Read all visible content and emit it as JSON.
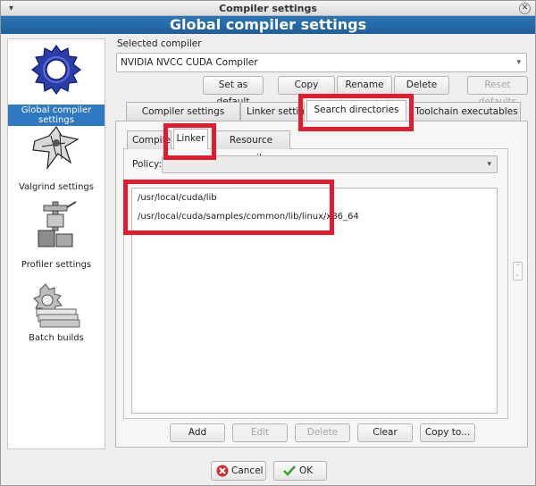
{
  "window": {
    "title": "Compiler settings",
    "menu_glyph": "▾",
    "close_glyph": "✕"
  },
  "banner": {
    "title": "Global compiler settings"
  },
  "sidebar": {
    "items": [
      {
        "label": "Global compiler settings",
        "icon": "gear-icon",
        "selected": true
      },
      {
        "label": "Valgrind settings",
        "icon": "valgrind-icon",
        "selected": false
      },
      {
        "label": "Profiler settings",
        "icon": "profiler-icon",
        "selected": false
      },
      {
        "label": "Batch builds",
        "icon": "batch-builds-icon",
        "selected": false
      }
    ]
  },
  "selected_compiler": {
    "label": "Selected compiler",
    "value": "NVIDIA NVCC CUDA Compiler"
  },
  "compiler_buttons": {
    "set_default": "Set as default",
    "copy": "Copy",
    "rename": "Rename",
    "delete": "Delete",
    "reset_defaults": "Reset defaults"
  },
  "main_tabs": [
    {
      "label": "Compiler settings",
      "active": false
    },
    {
      "label": "Linker settings",
      "active": false
    },
    {
      "label": "Search directories",
      "active": true
    },
    {
      "label": "Toolchain executables",
      "active": false
    }
  ],
  "sub_tabs": [
    {
      "label": "Compiler",
      "active": false
    },
    {
      "label": "Linker",
      "active": true
    },
    {
      "label": "Resource compiler",
      "active": false
    }
  ],
  "policy": {
    "label": "Policy:",
    "value": ""
  },
  "directories": [
    "/usr/local/cuda/lib",
    "/usr/local/cuda/samples/common/lib/linux/x86_64"
  ],
  "dir_buttons": {
    "add": "Add",
    "edit": "Edit",
    "delete": "Delete",
    "clear": "Clear",
    "copy_to": "Copy to..."
  },
  "dialog_buttons": {
    "cancel": "Cancel",
    "ok": "OK"
  },
  "colors": {
    "banner": "#2b76b6",
    "highlight": "#e21c2e",
    "selection": "#2f79c2"
  }
}
